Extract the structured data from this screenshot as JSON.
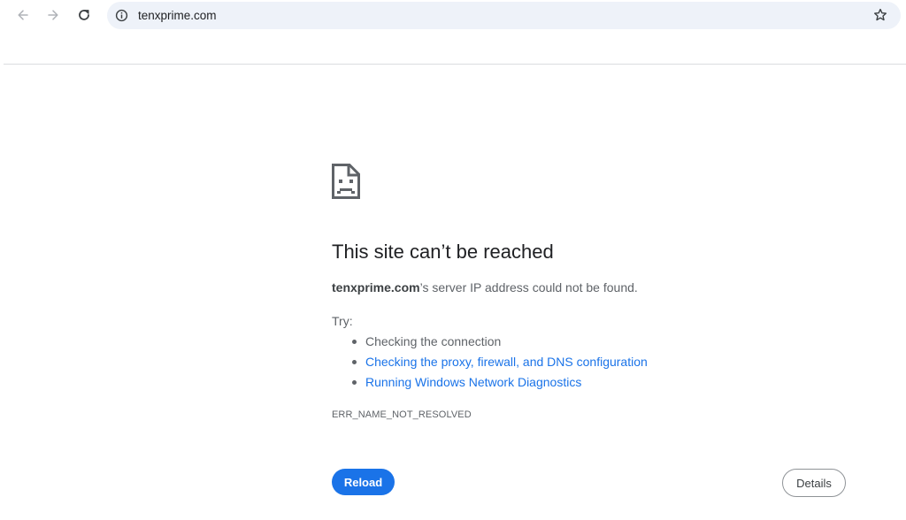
{
  "browser": {
    "url": "tenxprime.com",
    "icons": {
      "back": "arrow-left-icon",
      "forward": "arrow-right-icon",
      "reload": "reload-icon",
      "site_info": "info-circle-icon",
      "bookmark": "star-outline-icon"
    }
  },
  "error_page": {
    "icon": "sad-page-icon",
    "title": "This site can’t be reached",
    "summary_host": "tenxprime.com",
    "summary_rest": "’s server IP address could not be found.",
    "try_label": "Try:",
    "suggestions": [
      {
        "text": "Checking the connection",
        "is_link": false
      },
      {
        "text": "Checking the proxy, firewall, and DNS configuration",
        "is_link": true
      },
      {
        "text": "Running Windows Network Diagnostics",
        "is_link": true
      }
    ],
    "error_code": "ERR_NAME_NOT_RESOLVED",
    "reload_label": "Reload",
    "details_label": "Details"
  },
  "colors": {
    "accent": "#1a73e8",
    "omnibox_bg": "#eef2f9",
    "text_primary": "#202124",
    "text_secondary": "#5f6368"
  }
}
